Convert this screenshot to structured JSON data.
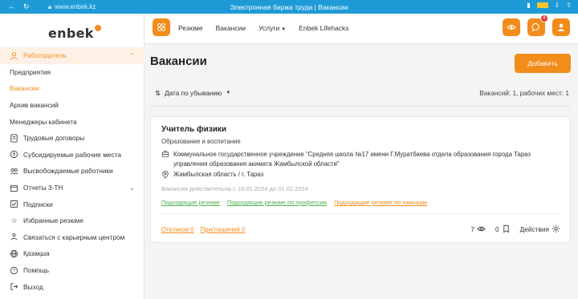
{
  "browser": {
    "url": "www.enbek.kz",
    "tab_title": "Электронная биржа труда | Вакансии"
  },
  "brand": {
    "logo_text": "enbek",
    "accent": "#f28c1b",
    "chrome": "#1e9bd7"
  },
  "sidebar": {
    "items": [
      {
        "label": "Работодатель",
        "icon": "user-icon"
      },
      {
        "label": "Предприятия"
      },
      {
        "label": "Вакансии"
      },
      {
        "label": "Архив вакансий"
      },
      {
        "label": "Менеджеры кабинета"
      },
      {
        "label": "Трудовые договоры",
        "icon": "document-icon"
      },
      {
        "label": "Субсидируемые рабочие места",
        "icon": "coins-icon"
      },
      {
        "label": "Высвобождаемые работники",
        "icon": "users-icon"
      },
      {
        "label": "Отчеты 3-ТН",
        "icon": "calendar-icon"
      },
      {
        "label": "Подписки",
        "icon": "checkbox-icon"
      },
      {
        "label": "Избранные резюме",
        "icon": "star-icon"
      },
      {
        "label": "Связаться с карьерным центром",
        "icon": "people-icon"
      },
      {
        "label": "Қазақша",
        "icon": "globe-icon"
      },
      {
        "label": "Помощь",
        "icon": "help-icon"
      },
      {
        "label": "Выход",
        "icon": "logout-icon"
      }
    ]
  },
  "topnav": {
    "items": [
      "Резюме",
      "Вакансии",
      "Услуги",
      "Enbek Lifehacks"
    ],
    "notifications_count": "4"
  },
  "main": {
    "title": "Вакансии",
    "add_button": "Добавить",
    "sort_label": "Дата по убыванию",
    "count_text": "Вакансий: 1, рабочих мест: 1"
  },
  "vacancy": {
    "title": "Учитель физики",
    "category": "Образование и воспитание",
    "organization": "Коммунальное государственное учреждение \"Средняя школа №17 имени Г.Муратбаева отдела образования города Тараз управления образования акимата Жамбылской области\"",
    "location": "Жамбылская область / г. Тараз",
    "validity": "Вакансия действительна с 18.01.2024 до 01.02.2024",
    "links": [
      "Подходящие резюме",
      "Подходящие резюме по профессии",
      "Подходящие резюме по навыкам"
    ],
    "responses": "Откликов 0",
    "invitations": "Приглашений 0",
    "views": "7",
    "saved": "0",
    "actions_label": "Действия"
  }
}
